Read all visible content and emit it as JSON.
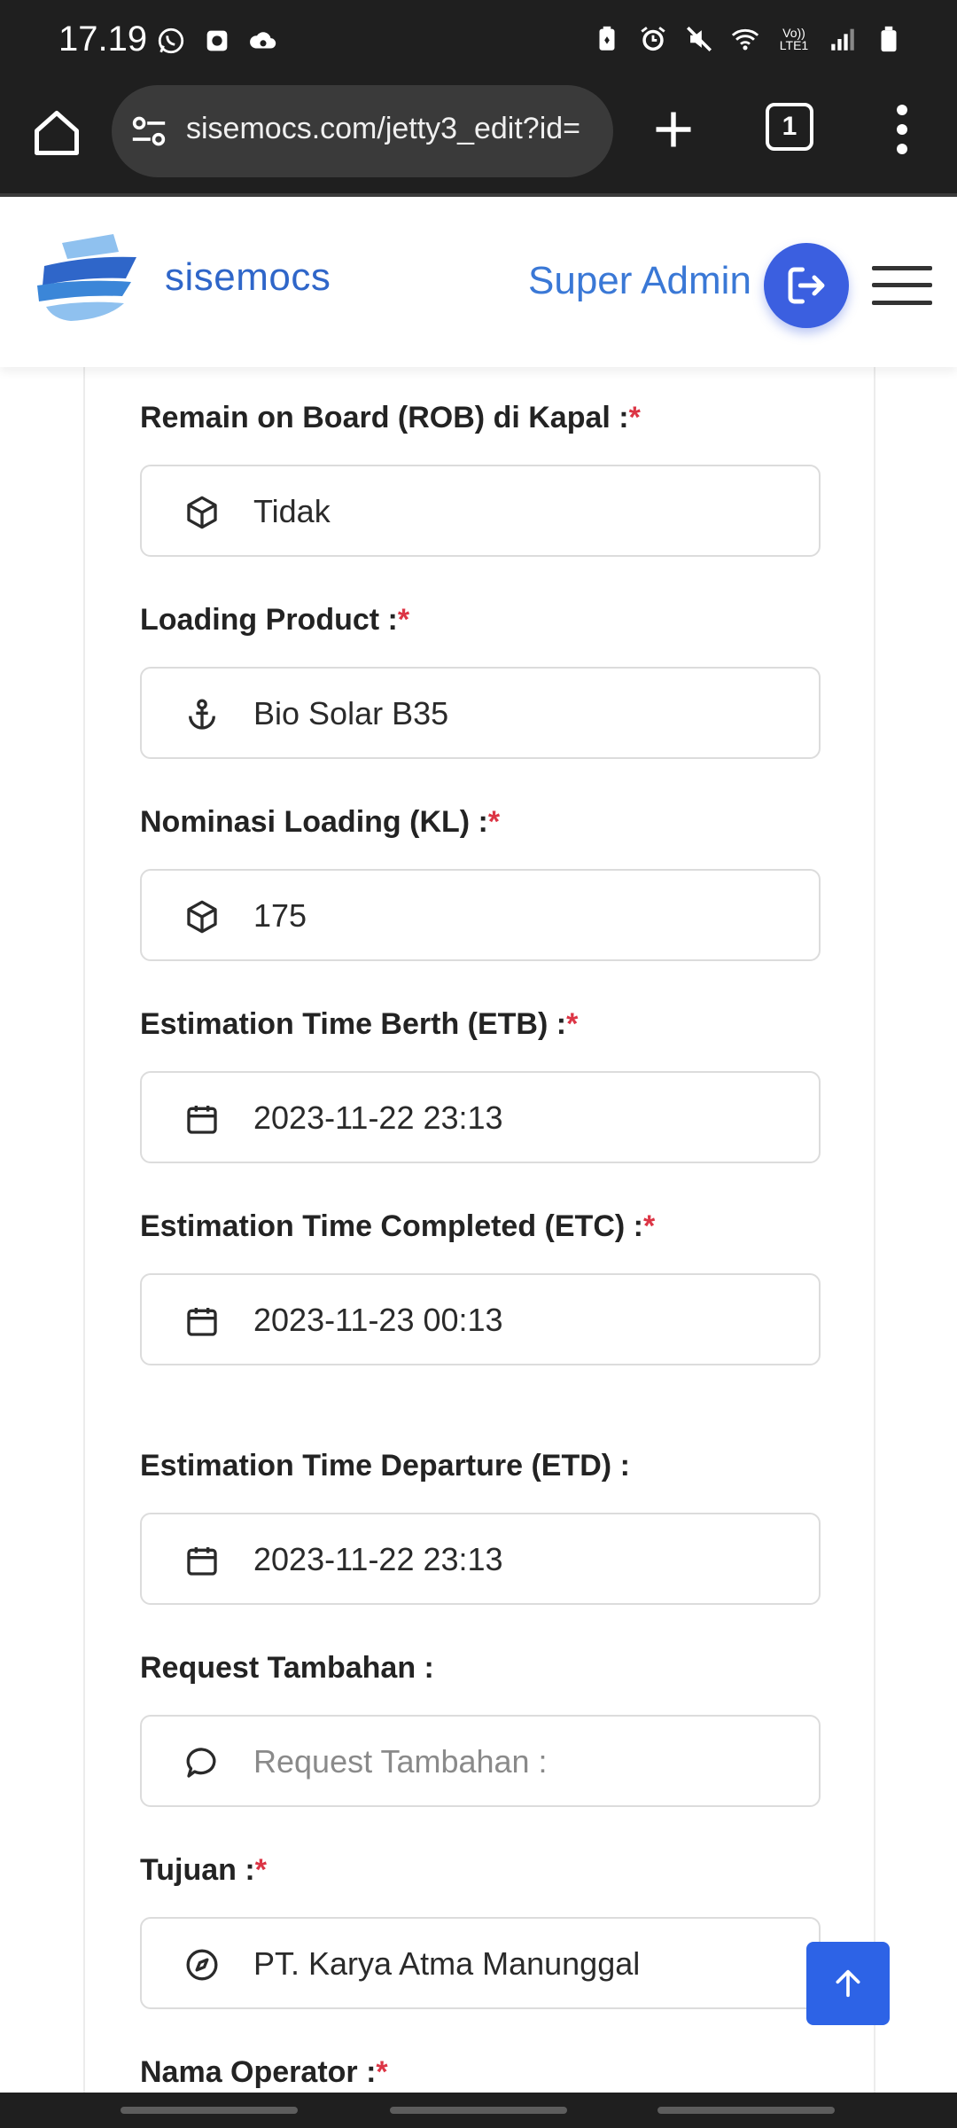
{
  "status_bar": {
    "time": "17.19",
    "left_icons": [
      "whatsapp-icon",
      "instagram-icon",
      "cloud-sync-icon"
    ],
    "right_icons": [
      "battery-saver-icon",
      "alarm-icon",
      "mute-icon",
      "wifi-icon",
      "volte-icon",
      "signal-icon",
      "battery-icon"
    ],
    "volte_label": "Vo)) LTE1"
  },
  "browser": {
    "url": "sisemocs.com/jetty3_edit?id=",
    "tab_count": "1"
  },
  "header": {
    "brand": "sisemocs",
    "user": "Super Admin",
    "brand_color": "#2f66c9",
    "accent_color": "#3b5fe0"
  },
  "form": {
    "fields": [
      {
        "label": "Remain on Board (ROB) di Kapal :",
        "required": "*",
        "value": "Tidak",
        "icon": "box-icon"
      },
      {
        "label": "Loading Product :",
        "required": "*",
        "value": "Bio Solar B35",
        "icon": "anchor-icon"
      },
      {
        "label": "Nominasi Loading (KL) :",
        "required": "*",
        "value": "175",
        "icon": "box-icon"
      },
      {
        "label": "Estimation Time Berth (ETB) :",
        "required": "*",
        "value": "2023-11-22 23:13",
        "icon": "calendar-icon"
      },
      {
        "label": "Estimation Time Completed (ETC) :",
        "required": "*",
        "value": "2023-11-23 00:13",
        "icon": "calendar-icon"
      },
      {
        "label": "Estimation Time Departure (ETD) :",
        "required": "",
        "value": "2023-11-22 23:13",
        "icon": "calendar-icon"
      },
      {
        "label": "Request Tambahan :",
        "required": "",
        "placeholder": "Request Tambahan :",
        "icon": "comment-icon"
      },
      {
        "label": "Tujuan :",
        "required": "*",
        "value": "PT. Karya Atma Manunggal",
        "icon": "compass-icon"
      },
      {
        "label": "Nama Operator :",
        "required": "*"
      }
    ]
  }
}
